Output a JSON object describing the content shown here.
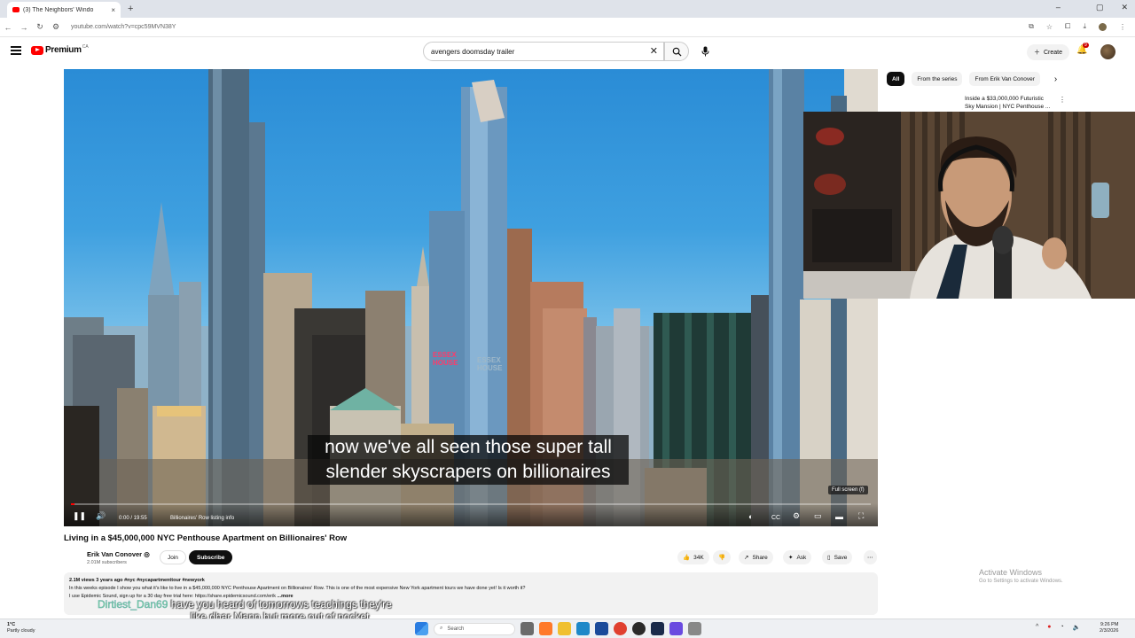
{
  "browser": {
    "tab_title": "(3) The Neighbors' Windo",
    "tab_close": "×",
    "new_tab": "+",
    "url": "youtube.com/watch?v=cpc59MVN38Y",
    "window_controls": [
      "–",
      "▢",
      "✕"
    ]
  },
  "yt_header": {
    "logo_text": "Premium",
    "logo_country": "CA",
    "search_value": "avengers doomsday trailer",
    "search_clear": "✕",
    "search_icon_glyph": "⌕",
    "mic_glyph": "🎙",
    "create_label": "Create",
    "notif_count": "9"
  },
  "player": {
    "caption_line1": "now we've all seen those super tall",
    "caption_line2": "slender skyscrapers on billionaires",
    "fullscreen_tip": "Full screen (f)",
    "time": "0:00 / 19:55",
    "chapter": "Billionaires' Row listing info",
    "progress_fraction": 0.0,
    "signs": [
      "ESSEX",
      "HOUSE",
      "ESSEX",
      "HOUSE"
    ]
  },
  "sidebar": {
    "chips": [
      "All",
      "From the series",
      "From Erik Van Conover"
    ],
    "next_glyph": "›",
    "video_title": "Inside a $33,000,000 Futuristic Sky Mansion | NYC Penthouse ...",
    "more_glyph": "⋮"
  },
  "video": {
    "title": "Living in a $45,000,000 NYC Penthouse Apartment on Billionaires' Row",
    "channel_name": "Erik Van Conover ◎",
    "subscribers": "2.01M subscribers",
    "join_label": "Join",
    "subscribe_label": "Subscribe",
    "likes": "34K",
    "share_label": "Share",
    "ask_label": "Ask",
    "save_label": "Save",
    "more_glyph": "⋯",
    "desc_stats": "2.1M views  3 years ago  #nyc #nycapartmenttour #newyork",
    "desc_line1": "In this weeks episode I show you what it's like to live in a $45,000,000 NYC Penthouse Apartment on Billionaires' Row. This is one of the most expensive New York apartment tours we have done yet! Is it worth it?",
    "desc_line2": "I use Epidemic Sound, sign up for a 30 day free trial here: https://share.epidemicsound.com/erik",
    "desc_more": "...more"
  },
  "chat": {
    "user": "Dirtiest_Dan69",
    "msg1": "have you heard of tomorrows teachings they're",
    "msg2": "like dhar Mann but more out of pocket"
  },
  "watermark": {
    "line1": "Activate Windows",
    "line2": "Go to Settings to activate Windows."
  },
  "taskbar": {
    "temp": "1°C",
    "weather": "Partly cloudy",
    "search_label": "Search",
    "time": "9:26 PM",
    "date": "2/3/2026"
  },
  "colors": {
    "youtube_red": "#ff0000",
    "subscribe_bg": "#0f0f0f",
    "chip_bg": "#f2f2f2"
  }
}
